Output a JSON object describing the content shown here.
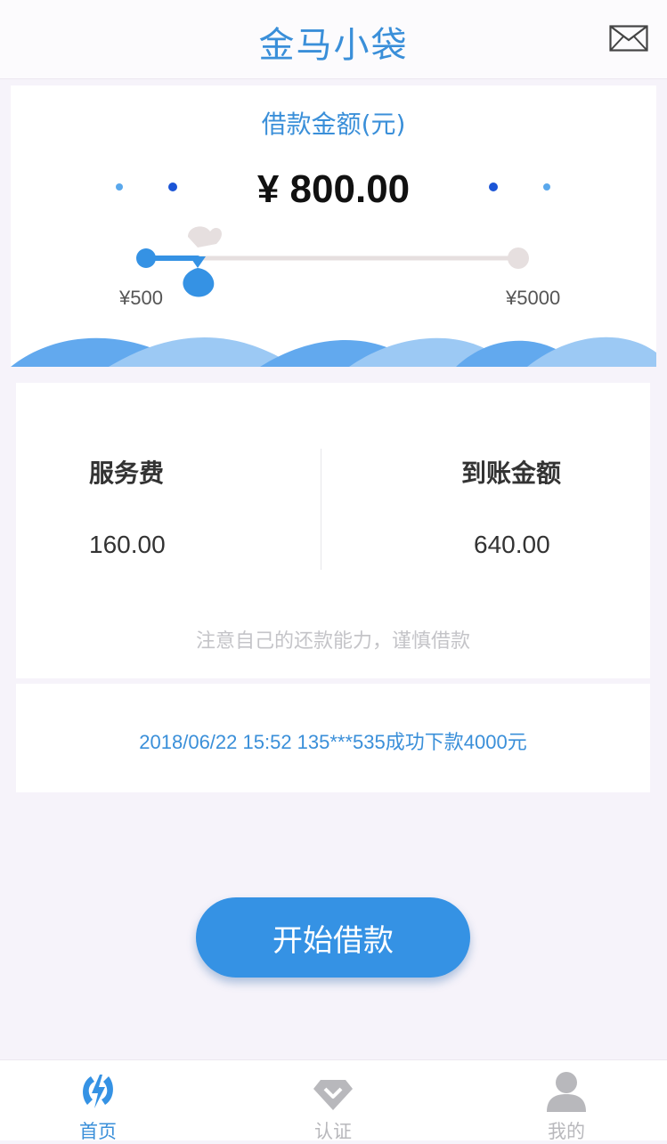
{
  "header": {
    "title": "金马小袋",
    "icon": "mail-icon"
  },
  "loan": {
    "label": "借款金额(元)",
    "amount_display": "¥ 800.00",
    "slider": {
      "min_label": "¥500",
      "max_label": "¥5000",
      "value": 800,
      "min": 500,
      "max": 5000
    }
  },
  "fees": {
    "service_fee_label": "服务费",
    "service_fee_value": "160.00",
    "received_label": "到账金额",
    "received_value": "640.00",
    "notice": "注意自己的还款能力，谨慎借款"
  },
  "ticker": {
    "text": "2018/06/22 15:52 135***535成功下款4000元"
  },
  "action": {
    "start_label": "开始借款"
  },
  "tabbar": {
    "items": [
      {
        "label": "首页",
        "icon": "home-bolt-icon",
        "active": true
      },
      {
        "label": "认证",
        "icon": "diamond-verify-icon",
        "active": false
      },
      {
        "label": "我的",
        "icon": "user-icon",
        "active": false
      }
    ]
  },
  "colors": {
    "accent": "#3a8fd9",
    "button": "#3592e4",
    "background": "#f6f3fa",
    "inactive": "#b8b8bc"
  }
}
